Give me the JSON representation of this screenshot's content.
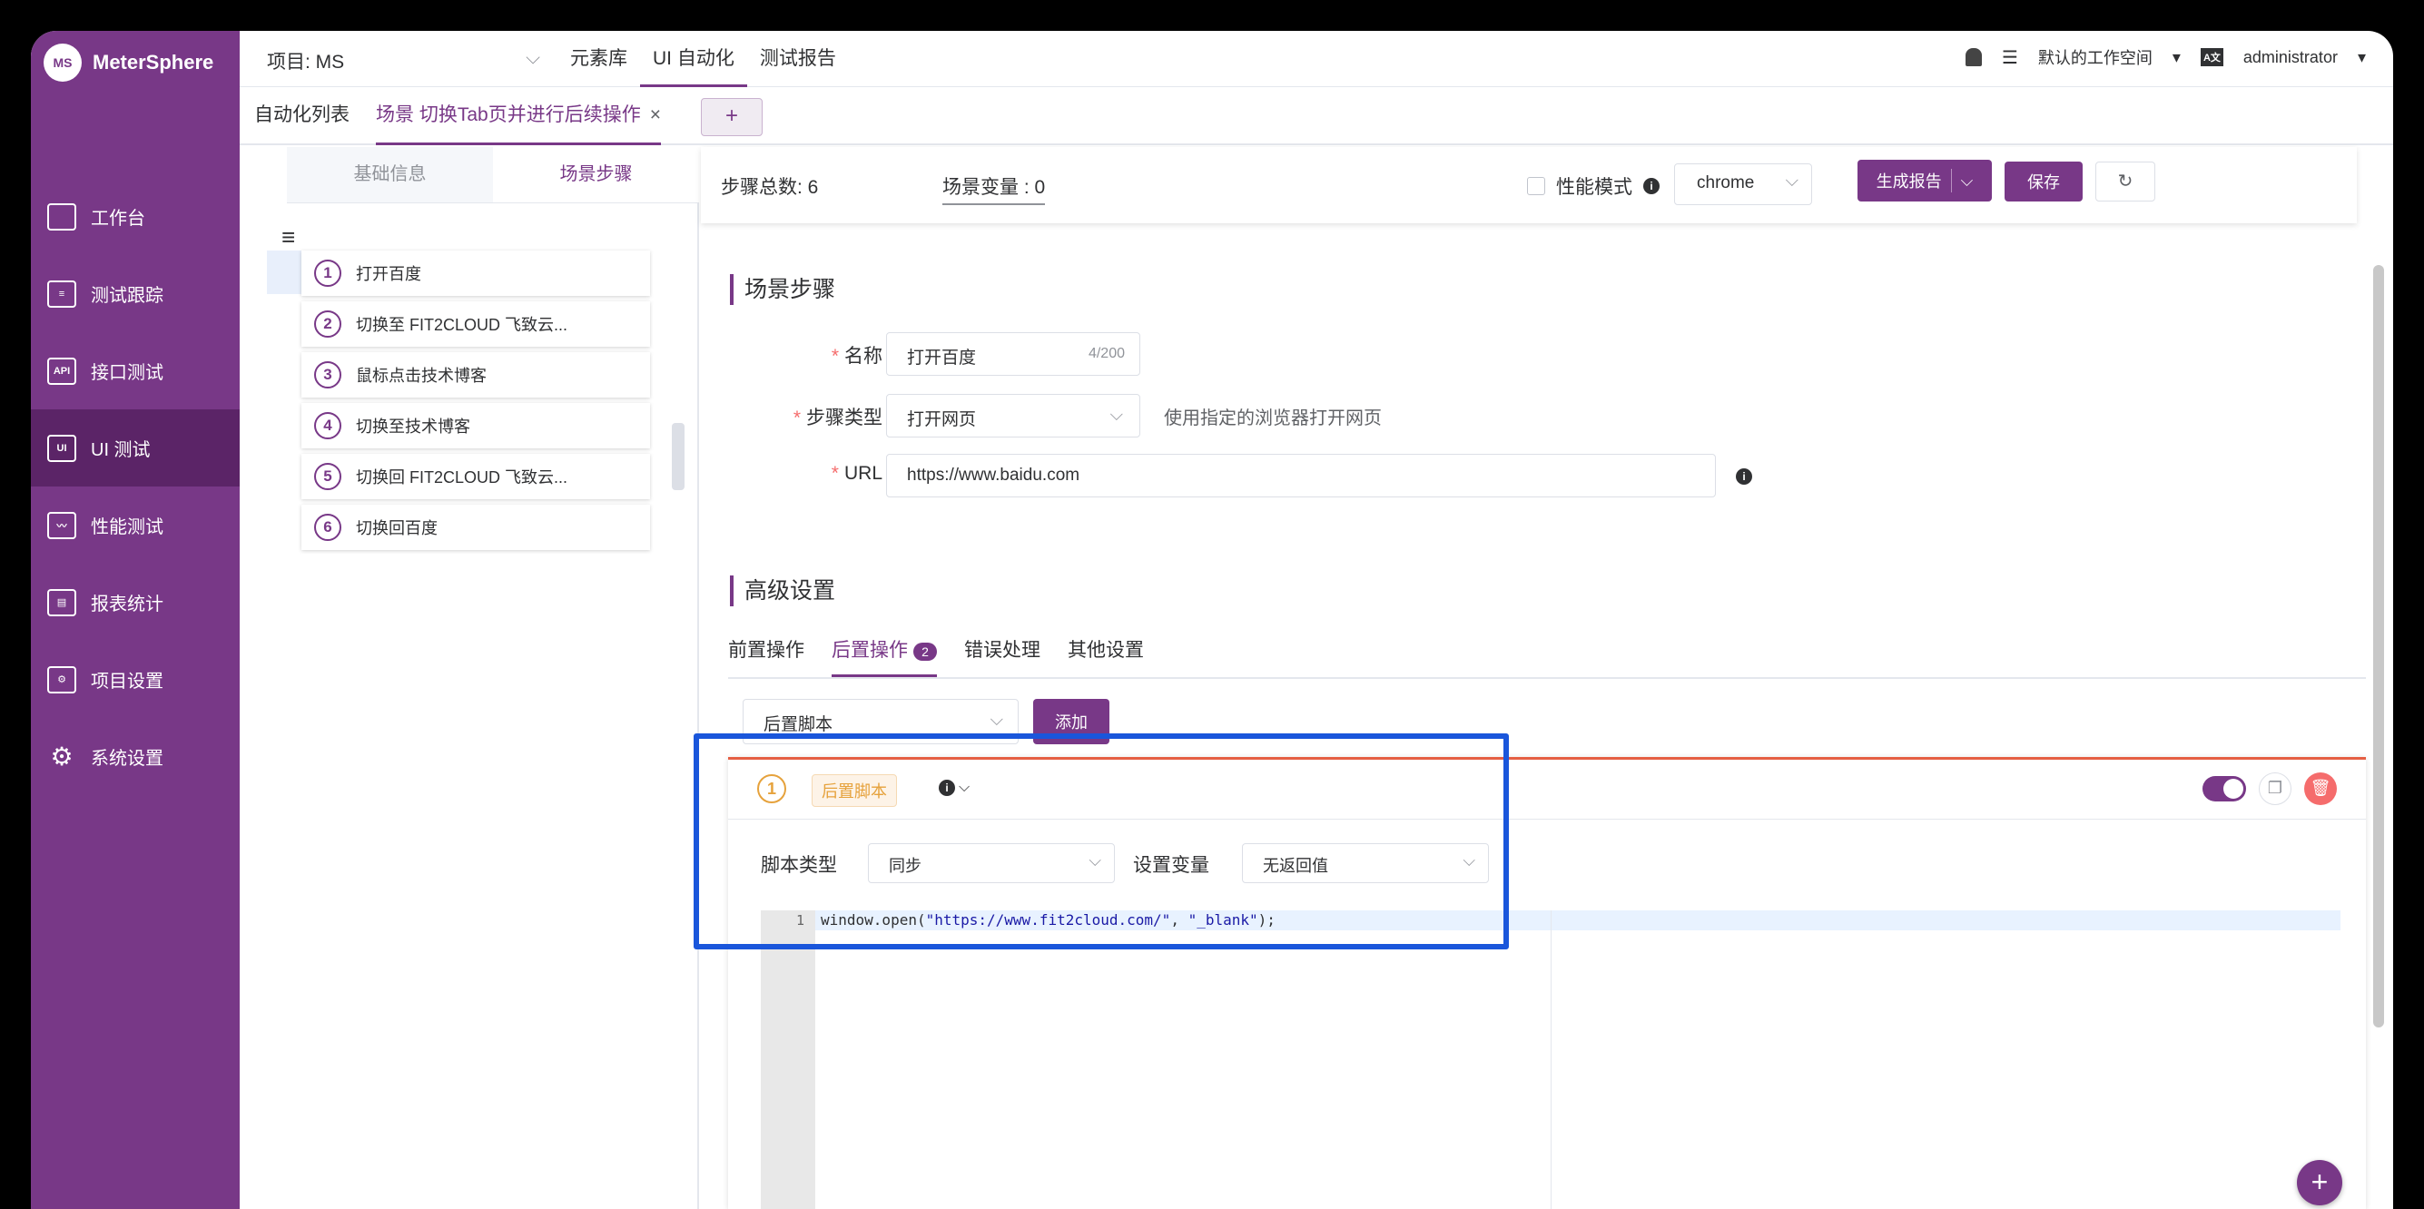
{
  "app": {
    "logo_text": "MeterSphere",
    "logo_mark": "MS",
    "accent_color": "#783887"
  },
  "sidebar": {
    "items": [
      {
        "label": "工作台",
        "icon": "monitor-icon"
      },
      {
        "label": "测试跟踪",
        "icon": "clipboard-icon"
      },
      {
        "label": "接口测试",
        "icon": "api-icon"
      },
      {
        "label": "UI 测试",
        "icon": "ui-icon"
      },
      {
        "label": "性能测试",
        "icon": "chart-icon"
      },
      {
        "label": "报表统计",
        "icon": "report-icon"
      },
      {
        "label": "项目设置",
        "icon": "folder-settings-icon"
      },
      {
        "label": "系统设置",
        "icon": "gear-icon"
      }
    ],
    "active_index": 3
  },
  "header": {
    "project_label": "项目: MS",
    "nav": [
      "元素库",
      "UI 自动化",
      "测试报告"
    ],
    "active_nav": "UI 自动化",
    "workspace": "默认的工作空间",
    "lang_badge": "A文",
    "user": "administrator"
  },
  "tabs": {
    "list_tab": "自动化列表",
    "scene_tab": "场景 切换Tab页并进行后续操作",
    "close": "×",
    "add": "+"
  },
  "left_panel": {
    "tab_basic": "基础信息",
    "tab_steps": "场景步骤",
    "steps": [
      {
        "num": "1",
        "label": "打开百度"
      },
      {
        "num": "2",
        "label": "切换至 FIT2CLOUD 飞致云..."
      },
      {
        "num": "3",
        "label": "鼠标点击技术博客"
      },
      {
        "num": "4",
        "label": "切换至技术博客"
      },
      {
        "num": "5",
        "label": "切换回 FIT2CLOUD 飞致云..."
      },
      {
        "num": "6",
        "label": "切换回百度"
      }
    ]
  },
  "toolbar": {
    "step_total": "步骤总数: 6",
    "scene_var": "场景变量 : 0",
    "perf_mode": "性能模式",
    "browser": "chrome",
    "gen_report": "生成报告",
    "save": "保存"
  },
  "scene_steps": {
    "title": "场景步骤",
    "name_label": "名称",
    "name_value": "打开百度",
    "name_count": "4/200",
    "type_label": "步骤类型",
    "type_value": "打开网页",
    "type_hint": "使用指定的浏览器打开网页",
    "url_label": "URL",
    "url_value": "https://www.baidu.com"
  },
  "advanced": {
    "title": "高级设置",
    "tabs": [
      "前置操作",
      "后置操作",
      "错误处理",
      "其他设置"
    ],
    "post_badge": "2",
    "post_select": "后置脚本",
    "add_button": "添加"
  },
  "script_card": {
    "num": "1",
    "tag": "后置脚本",
    "enabled": true,
    "script_type_label": "脚本类型",
    "script_type_value": "同步",
    "set_var_label": "设置变量",
    "set_var_value": "无返回值",
    "line_number": "1",
    "code_prefix": "window.open(",
    "code_arg1": "\"https://www.fit2cloud.com/\"",
    "code_sep": ", ",
    "code_arg2": "\"_blank\"",
    "code_suffix": ");"
  },
  "fab": "+"
}
